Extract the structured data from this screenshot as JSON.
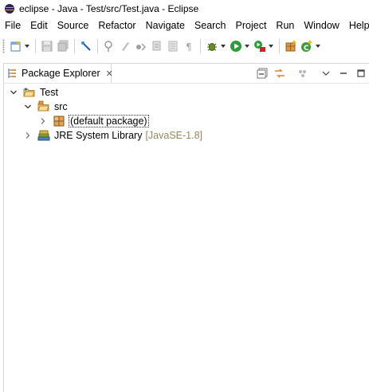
{
  "window": {
    "title": "eclipse - Java - Test/src/Test.java - Eclipse"
  },
  "menubar": {
    "items": [
      "File",
      "Edit",
      "Source",
      "Refactor",
      "Navigate",
      "Search",
      "Project",
      "Run",
      "Window",
      "Help"
    ]
  },
  "toolbar": {
    "buttons": [
      "new-wizard-icon",
      "save-icon",
      "save-all-icon",
      "toggle-breadcrumb-icon",
      "skip-breakpoints-icon",
      "toggle-mark-occurrences-icon",
      "next-annotation-icon",
      "previous-annotation-icon",
      "open-type-icon",
      "show-whitespace-icon",
      "debug-icon",
      "run-icon",
      "external-tools-icon",
      "new-java-package-icon",
      "new-java-class-icon"
    ]
  },
  "package_explorer": {
    "tab_label": "Package Explorer",
    "close_glyph": "✕",
    "actions": [
      "collapse-all-icon",
      "link-with-editor-icon",
      "focus-active-task-icon",
      "view-menu-icon",
      "minimize-icon",
      "maximize-icon"
    ],
    "tree": {
      "project": {
        "label": "Test",
        "expanded": true
      },
      "src": {
        "label": "src",
        "expanded": true
      },
      "package": {
        "label": "(default package)",
        "expanded": false
      },
      "library": {
        "label": "JRE System Library",
        "decoration": "[JavaSE-1.8]",
        "expanded": false
      }
    }
  },
  "colors": {
    "decoration": "#95885f",
    "folder": "#e8b64c",
    "package": "#c98a3c",
    "run": "#2e9c3a"
  }
}
